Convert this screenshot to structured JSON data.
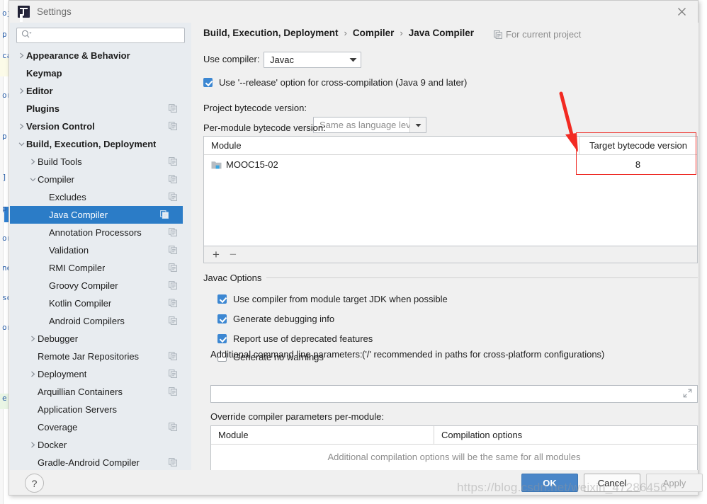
{
  "window": {
    "title": "Settings",
    "logo_icon": "intellij-idea-logo-icon",
    "close_icon": "close-icon"
  },
  "search": {
    "value": "",
    "placeholder": "",
    "icon": "search-icon",
    "dropdown_icon": "chevron-down-icon"
  },
  "sidebar": {
    "scrollbar": "vertical-scrollbar",
    "items": [
      {
        "label": "Appearance & Behavior",
        "indent": 0,
        "twisty": "chevron-right-icon",
        "bold": true,
        "copy": false,
        "selected": false
      },
      {
        "label": "Keymap",
        "indent": 0,
        "twisty": "none",
        "bold": true,
        "copy": false,
        "selected": false
      },
      {
        "label": "Editor",
        "indent": 0,
        "twisty": "chevron-right-icon",
        "bold": true,
        "copy": false,
        "selected": false
      },
      {
        "label": "Plugins",
        "indent": 0,
        "twisty": "none",
        "bold": true,
        "copy": true,
        "selected": false
      },
      {
        "label": "Version Control",
        "indent": 0,
        "twisty": "chevron-right-icon",
        "bold": true,
        "copy": true,
        "selected": false
      },
      {
        "label": "Build, Execution, Deployment",
        "indent": 0,
        "twisty": "chevron-down-icon",
        "bold": true,
        "copy": false,
        "selected": false
      },
      {
        "label": "Build Tools",
        "indent": 1,
        "twisty": "chevron-right-icon",
        "bold": false,
        "copy": true,
        "selected": false
      },
      {
        "label": "Compiler",
        "indent": 1,
        "twisty": "chevron-down-icon",
        "bold": false,
        "copy": true,
        "selected": false
      },
      {
        "label": "Excludes",
        "indent": 2,
        "twisty": "none",
        "bold": false,
        "copy": true,
        "selected": false
      },
      {
        "label": "Java Compiler",
        "indent": 2,
        "twisty": "none",
        "bold": false,
        "copy": true,
        "selected": true
      },
      {
        "label": "Annotation Processors",
        "indent": 2,
        "twisty": "none",
        "bold": false,
        "copy": true,
        "selected": false
      },
      {
        "label": "Validation",
        "indent": 2,
        "twisty": "none",
        "bold": false,
        "copy": true,
        "selected": false
      },
      {
        "label": "RMI Compiler",
        "indent": 2,
        "twisty": "none",
        "bold": false,
        "copy": true,
        "selected": false
      },
      {
        "label": "Groovy Compiler",
        "indent": 2,
        "twisty": "none",
        "bold": false,
        "copy": true,
        "selected": false
      },
      {
        "label": "Kotlin Compiler",
        "indent": 2,
        "twisty": "none",
        "bold": false,
        "copy": true,
        "selected": false
      },
      {
        "label": "Android Compilers",
        "indent": 2,
        "twisty": "none",
        "bold": false,
        "copy": true,
        "selected": false
      },
      {
        "label": "Debugger",
        "indent": 1,
        "twisty": "chevron-right-icon",
        "bold": false,
        "copy": false,
        "selected": false
      },
      {
        "label": "Remote Jar Repositories",
        "indent": 1,
        "twisty": "none",
        "bold": false,
        "copy": true,
        "selected": false
      },
      {
        "label": "Deployment",
        "indent": 1,
        "twisty": "chevron-right-icon",
        "bold": false,
        "copy": true,
        "selected": false
      },
      {
        "label": "Arquillian Containers",
        "indent": 1,
        "twisty": "none",
        "bold": false,
        "copy": true,
        "selected": false
      },
      {
        "label": "Application Servers",
        "indent": 1,
        "twisty": "none",
        "bold": false,
        "copy": false,
        "selected": false
      },
      {
        "label": "Coverage",
        "indent": 1,
        "twisty": "none",
        "bold": false,
        "copy": true,
        "selected": false
      },
      {
        "label": "Docker",
        "indent": 1,
        "twisty": "chevron-right-icon",
        "bold": false,
        "copy": false,
        "selected": false
      },
      {
        "label": "Gradle-Android Compiler",
        "indent": 1,
        "twisty": "none",
        "bold": false,
        "copy": true,
        "selected": false
      }
    ]
  },
  "breadcrumb": {
    "part1": "Build, Execution, Deployment",
    "part2": "Compiler",
    "part3": "Java Compiler",
    "separator": "›",
    "scope_label": "For current project",
    "scope_icon": "copy-scope-icon"
  },
  "compiler": {
    "use_compiler_label": "Use compiler:",
    "use_compiler_value": "Javac",
    "release_option_label": "Use '--release' option for cross-compilation (Java 9 and later)",
    "release_option_checked": true,
    "project_bytecode_label": "Project bytecode version:",
    "project_bytecode_value": "Same as language level",
    "per_module_label": "Per-module bytecode version:"
  },
  "module_table": {
    "columns": [
      "Module",
      "Target bytecode version"
    ],
    "rows": [
      {
        "module": "MOOC15-02",
        "target": "8",
        "icon": "module-folder-icon"
      }
    ],
    "add_button": "+",
    "remove_button": "−"
  },
  "javac_options": {
    "group_title": "Javac Options",
    "checkboxes": [
      {
        "label": "Use compiler from module target JDK when possible",
        "checked": true
      },
      {
        "label": "Generate debugging info",
        "checked": true
      },
      {
        "label": "Report use of deprecated features",
        "checked": true
      },
      {
        "label": "Generate no warnings",
        "checked": false
      }
    ],
    "additional_params_label": "Additional command line parameters:",
    "additional_params_hint": "('/' recommended in paths for cross-platform configurations)",
    "additional_params_value": "",
    "expand_icon": "expand-editor-icon"
  },
  "override_table": {
    "title": "Override compiler parameters per-module:",
    "columns": [
      "Module",
      "Compilation options"
    ],
    "empty_message": "Additional compilation options will be the same for all modules"
  },
  "footer": {
    "help_label": "?",
    "ok_label": "OK",
    "cancel_label": "Cancel",
    "apply_label": "Apply"
  },
  "annotation": {
    "highlight_box": "red-rectangle-highlight",
    "arrow": "red-arrow-annotation"
  },
  "watermark": {
    "text": "https://blog.csdn.net/weixin_47286456"
  },
  "background_editor": {
    "fragments": [
      "oj",
      "p;",
      "ca",
      "or",
      "p;",
      "]",
      "p;",
      "or",
      "ne",
      "so",
      "or",
      "e"
    ]
  },
  "colors": {
    "selection_blue": "#2b7cc7",
    "ok_button_blue": "#4a86c8",
    "checkbox_blue": "#3c87d2",
    "annotation_red": "#ee2b26",
    "sidebar_bg": "#e8ecf0",
    "panel_bg": "#f0f0f0"
  }
}
